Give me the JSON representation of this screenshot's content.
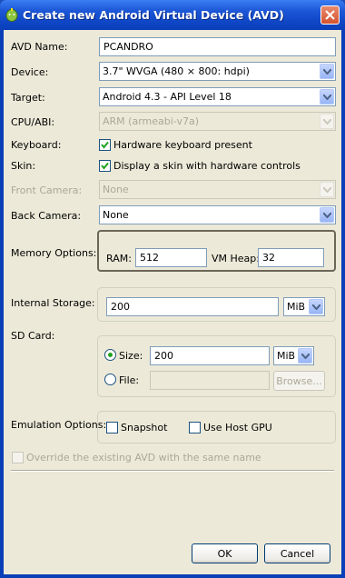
{
  "window": {
    "title": "Create new Android Virtual Device (AVD)"
  },
  "form": {
    "avd_name": {
      "label": "AVD Name:",
      "value": "PCANDRO"
    },
    "device": {
      "label": "Device:",
      "value": "3.7\" WVGA (480 × 800: hdpi)"
    },
    "target": {
      "label": "Target:",
      "value": "Android 4.3 - API Level 18"
    },
    "cpu_abi": {
      "label": "CPU/ABI:",
      "value": "ARM (armeabi-v7a)"
    },
    "keyboard": {
      "label": "Keyboard:",
      "checkbox": "Hardware keyboard present",
      "checked": true
    },
    "skin": {
      "label": "Skin:",
      "checkbox": "Display a skin with hardware controls",
      "checked": true
    },
    "front_camera": {
      "label": "Front Camera:",
      "value": "None"
    },
    "back_camera": {
      "label": "Back Camera:",
      "value": "None"
    },
    "memory": {
      "label": "Memory Options:",
      "ram_label": "RAM:",
      "ram_value": "512",
      "vm_heap_label": "VM Heap:",
      "vm_heap_value": "32"
    },
    "internal_storage": {
      "label": "Internal Storage:",
      "value": "200",
      "unit": "MiB"
    },
    "sd_card": {
      "label": "SD Card:",
      "size_label": "Size:",
      "size_value": "200",
      "size_unit": "MiB",
      "size_selected": true,
      "file_label": "File:",
      "file_value": "",
      "browse_label": "Browse..."
    },
    "emulation": {
      "label": "Emulation Options:",
      "snapshot_label": "Snapshot",
      "snapshot_checked": false,
      "host_gpu_label": "Use Host GPU",
      "host_gpu_checked": false
    },
    "override": {
      "label": "Override the existing AVD with the same name",
      "checked": false
    }
  },
  "buttons": {
    "ok": "OK",
    "cancel": "Cancel"
  },
  "colors": {
    "titlebar": "#0a3fb8",
    "dialog_bg": "#ece9d8",
    "field_border": "#7f9db9",
    "close_button": "#d4532f"
  }
}
